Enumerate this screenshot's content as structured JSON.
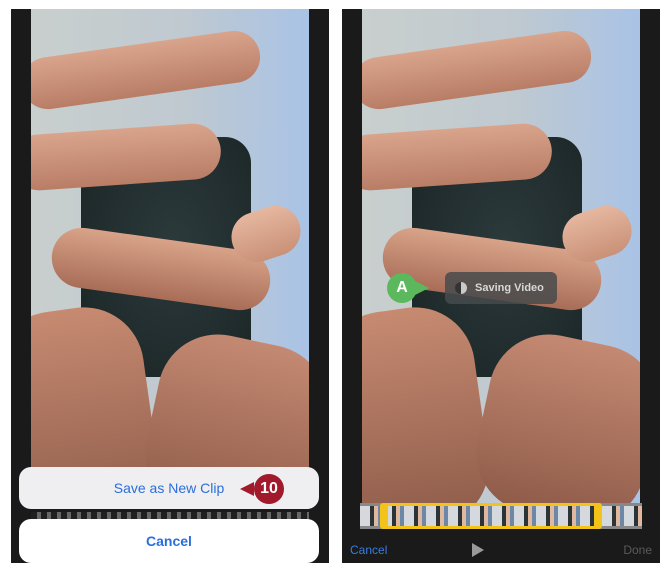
{
  "left_screen": {
    "action_sheet": {
      "save_label": "Save as New Clip",
      "cancel_label": "Cancel"
    },
    "callout_step": "10"
  },
  "right_screen": {
    "status_hud": {
      "label": "Saving Video"
    },
    "callout_label": "A",
    "toolbar": {
      "cancel_label": "Cancel",
      "play_icon": "play-icon",
      "done_label": "Done"
    }
  },
  "colors": {
    "accent_blue": "#2a6edc",
    "step_callout": "#a01a2b",
    "annotation_callout": "#5cb85c",
    "trim_handle": "#f3c31a"
  }
}
